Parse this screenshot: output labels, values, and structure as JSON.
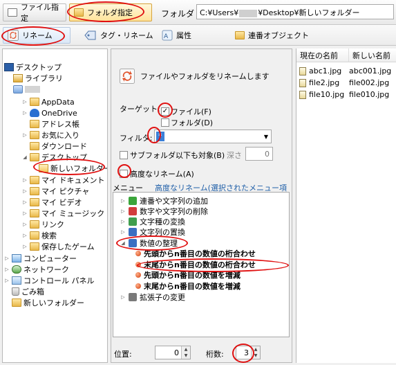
{
  "topbar": {
    "file_mode_label": "ファイル指定",
    "folder_mode_label": "フォルダ指定",
    "folder_label": "フォルダ",
    "path_prefix": "C:¥Users¥",
    "path_suffix": "¥Desktop¥新しいフォルダー"
  },
  "toolbar": {
    "rename": "リネーム",
    "tag_rename": "タグ・リネーム",
    "attributes": "属性",
    "sequential_object": "連番オブジェクト"
  },
  "tree": {
    "items": [
      {
        "label": "デスクトップ",
        "icon": "desktop-icon"
      },
      {
        "label": "ライブラリ",
        "icon": "library-icon"
      },
      {
        "label": "",
        "icon": "user-icon"
      },
      {
        "label": "AppData",
        "icon": "folder-icon"
      },
      {
        "label": "OneDrive",
        "icon": "cloud-icon"
      },
      {
        "label": "アドレス帳",
        "icon": "folder-icon"
      },
      {
        "label": "お気に入り",
        "icon": "folder-icon"
      },
      {
        "label": "ダウンロード",
        "icon": "folder-icon"
      },
      {
        "label": "デスクトップ",
        "icon": "folder-icon"
      },
      {
        "label": "新しいフォルダー",
        "icon": "folder-open-icon"
      },
      {
        "label": "マイ ドキュメント",
        "icon": "folder-icon"
      },
      {
        "label": "マイ ピクチャ",
        "icon": "folder-icon"
      },
      {
        "label": "マイ ビデオ",
        "icon": "folder-icon"
      },
      {
        "label": "マイ ミュージック",
        "icon": "folder-icon"
      },
      {
        "label": "リンク",
        "icon": "folder-icon"
      },
      {
        "label": "検索",
        "icon": "folder-icon"
      },
      {
        "label": "保存したゲーム",
        "icon": "folder-icon"
      },
      {
        "label": "コンピューター",
        "icon": "computer-icon"
      },
      {
        "label": "ネットワーク",
        "icon": "network-icon"
      },
      {
        "label": "コントロール パネル",
        "icon": "control-panel-icon"
      },
      {
        "label": "ごみ箱",
        "icon": "trash-icon"
      },
      {
        "label": "新しいフォルダー",
        "icon": "folder-icon"
      }
    ]
  },
  "settings": {
    "description": "ファイルやフォルダをリネームします",
    "target_label": "ターゲット:",
    "target_file": "ファイル(F)",
    "target_folder": "フォルダ(D)",
    "filter_label": "フィルタ:",
    "filter_value": "*",
    "subfolder_label": "サブフォルダ以下も対象(B)",
    "depth_label": "深さ",
    "depth_value": "0",
    "advanced_label": "高度なリネーム(A)",
    "menu_label": "メニュー",
    "menu_selected": "高度なリネーム(選択されたメニュー項目)",
    "menu": [
      {
        "label": "連番や文字列の追加",
        "icon": "plus-icon",
        "bold": false
      },
      {
        "label": "数字や文字列の削除",
        "icon": "delete-icon",
        "bold": false
      },
      {
        "label": "文字種の変換",
        "icon": "convert-icon",
        "bold": false
      },
      {
        "label": "文字列の置換",
        "icon": "replace-icon",
        "bold": false
      },
      {
        "label": "数値の整理",
        "icon": "number-icon",
        "bold": false
      },
      {
        "label": "先頭からn番目の数値の桁合わせ",
        "icon": "bullet-icon",
        "bold": true
      },
      {
        "label": "末尾からn番目の数値の桁合わせ",
        "icon": "bullet-icon",
        "bold": true
      },
      {
        "label": "先頭からn番目の数値を増減",
        "icon": "bullet-icon",
        "bold": true
      },
      {
        "label": "末尾からn番目の数値を増減",
        "icon": "bullet-icon",
        "bold": true
      },
      {
        "label": "拡張子の変更",
        "icon": "extension-icon",
        "bold": false
      }
    ],
    "position_label": "位置:",
    "position_value": "0",
    "digits_label": "桁数:",
    "digits_value": "3"
  },
  "filelist": {
    "col_current": "現在の名前",
    "col_new": "新しい名前",
    "rows": [
      {
        "current": "abc1.jpg",
        "new": "abc001.jpg"
      },
      {
        "current": "file2.jpg",
        "new": "file002.jpg"
      },
      {
        "current": "file10.jpg",
        "new": "file010.jpg"
      }
    ]
  }
}
